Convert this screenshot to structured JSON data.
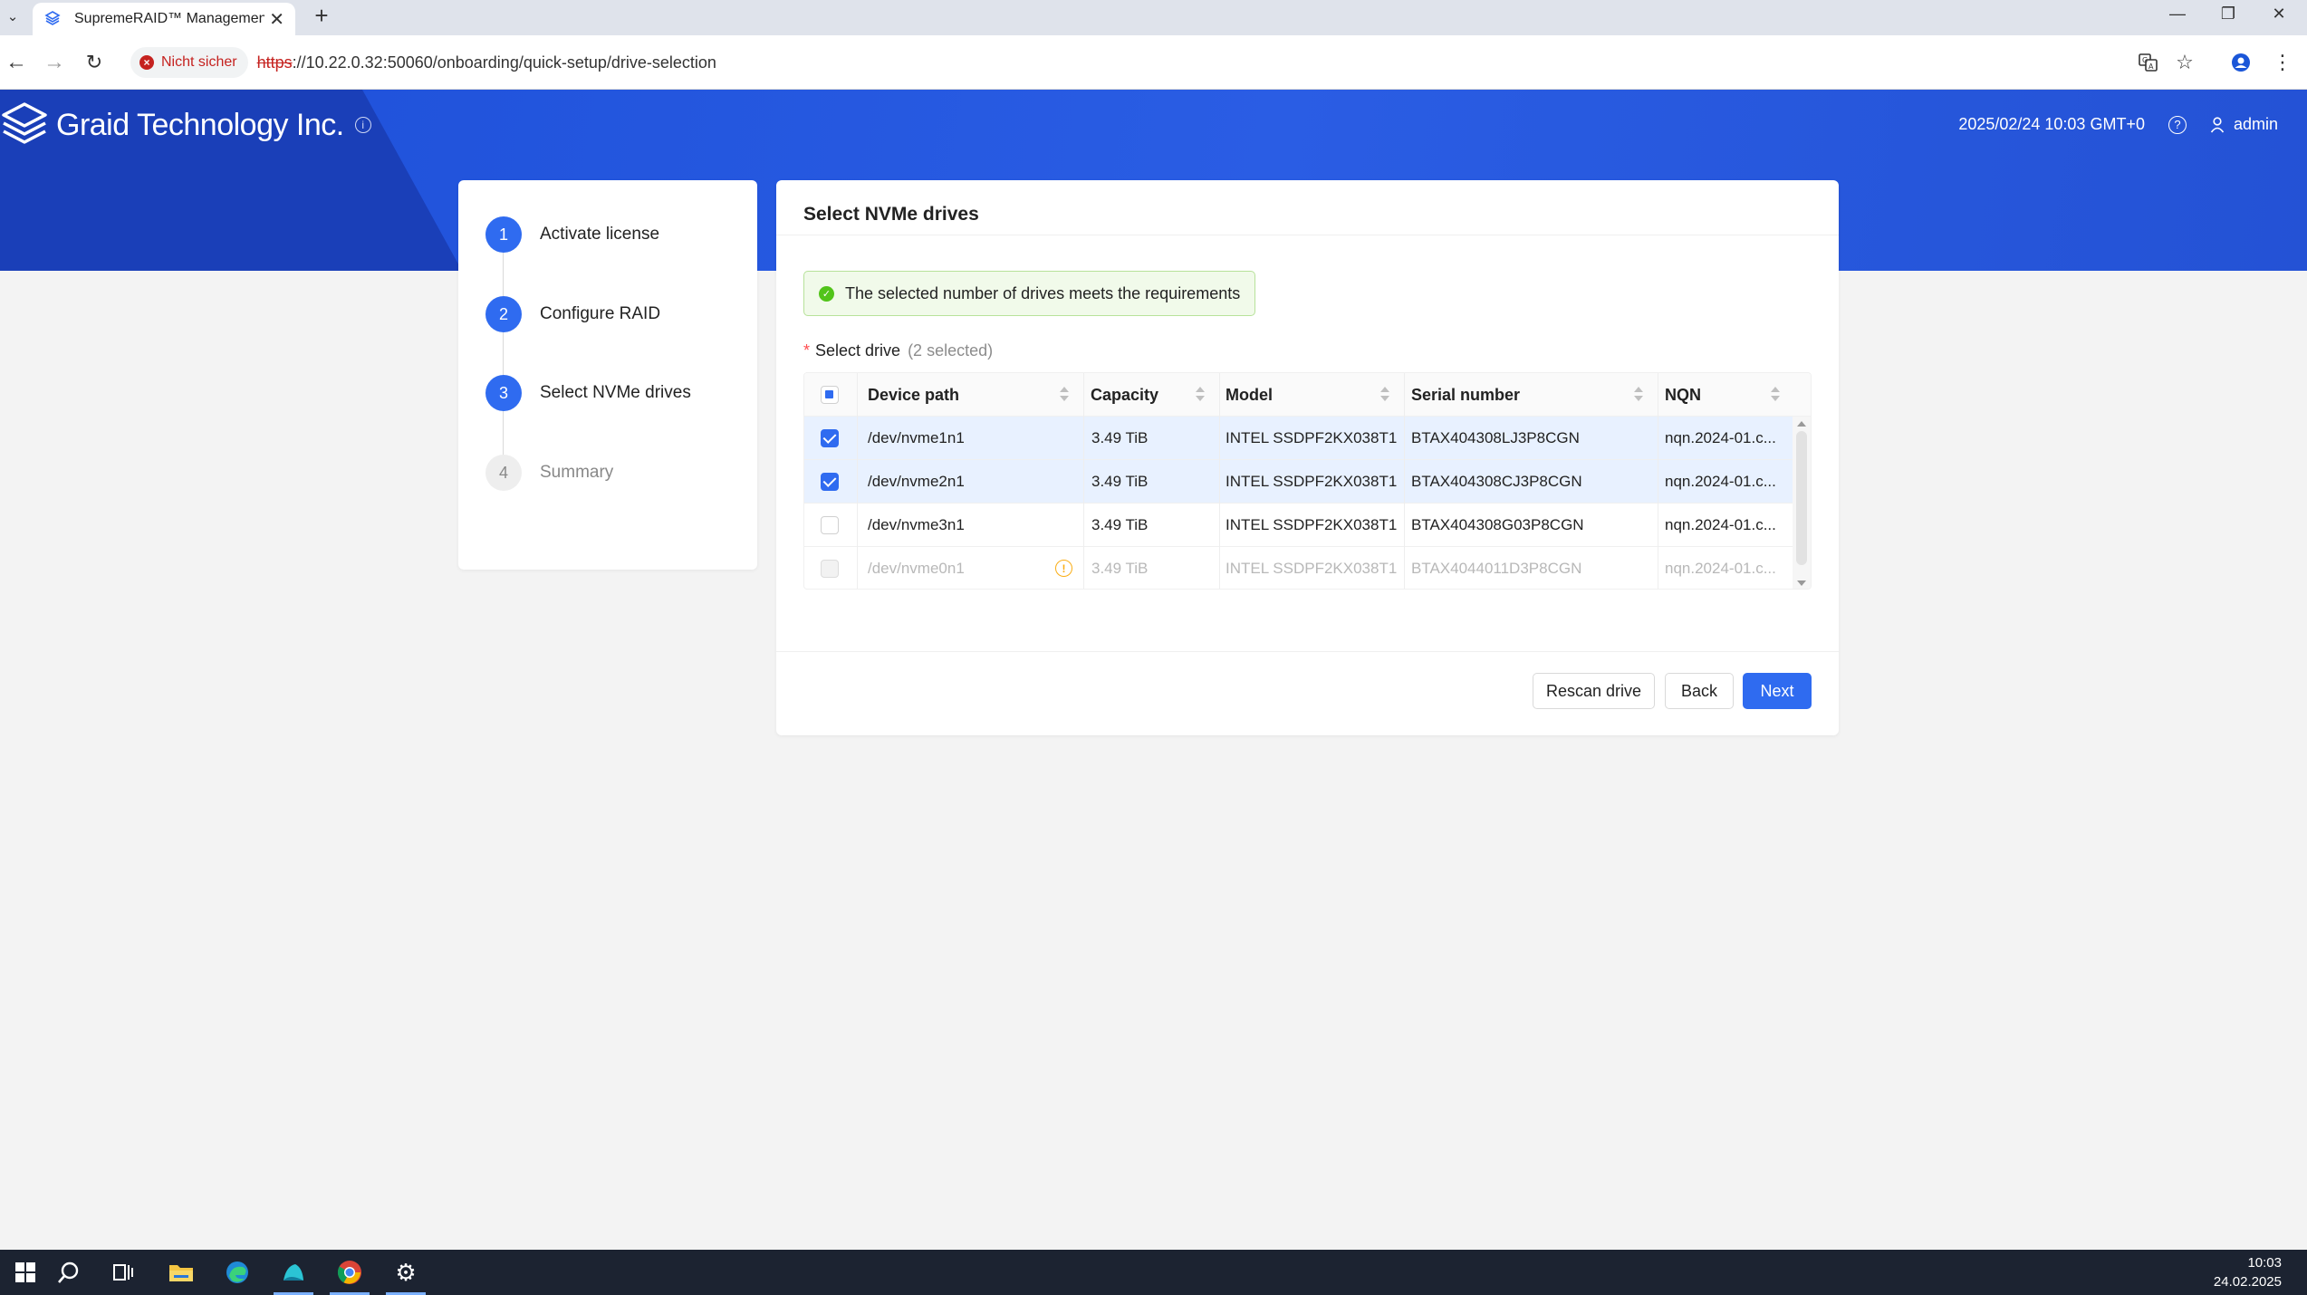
{
  "browser": {
    "tab_title": "SupremeRAID™ Management C",
    "security_label": "Nicht sicher",
    "url_scheme": "https",
    "url_rest": "://10.22.0.32:50060/onboarding/quick-setup/drive-selection"
  },
  "header": {
    "logo_text": "Graid Technology Inc.",
    "datetime": "2025/02/24 10:03 GMT+0",
    "username": "admin"
  },
  "steps": [
    {
      "num": "1",
      "label": "Activate license"
    },
    {
      "num": "2",
      "label": "Configure RAID"
    },
    {
      "num": "3",
      "label": "Select NVMe drives"
    },
    {
      "num": "4",
      "label": "Summary"
    }
  ],
  "main": {
    "title": "Select NVMe drives",
    "alert_text": "The selected number of drives meets the requirements",
    "field_label": "Select drive",
    "selected_count": "(2 selected)",
    "columns": [
      "Device path",
      "Capacity",
      "Model",
      "Serial number",
      "NQN"
    ],
    "rows": [
      {
        "path": "/dev/nvme1n1",
        "capacity": "3.49 TiB",
        "model": "INTEL SSDPF2KX038T1",
        "serial": "BTAX404308LJ3P8CGN",
        "nqn": "nqn.2024-01.c...",
        "checked": true,
        "disabled": false
      },
      {
        "path": "/dev/nvme2n1",
        "capacity": "3.49 TiB",
        "model": "INTEL SSDPF2KX038T1",
        "serial": "BTAX404308CJ3P8CGN",
        "nqn": "nqn.2024-01.c...",
        "checked": true,
        "disabled": false
      },
      {
        "path": "/dev/nvme3n1",
        "capacity": "3.49 TiB",
        "model": "INTEL SSDPF2KX038T1",
        "serial": "BTAX404308G03P8CGN",
        "nqn": "nqn.2024-01.c...",
        "checked": false,
        "disabled": false
      },
      {
        "path": "/dev/nvme0n1",
        "capacity": "3.49 TiB",
        "model": "INTEL SSDPF2KX038T1",
        "serial": "BTAX4044011D3P8CGN",
        "nqn": "nqn.2024-01.c...",
        "checked": false,
        "disabled": true
      }
    ],
    "buttons": {
      "rescan": "Rescan drive",
      "back": "Back",
      "next": "Next"
    }
  },
  "taskbar": {
    "time": "10:03",
    "date": "24.02.2025"
  },
  "colors": {
    "primary": "#2f6bf0",
    "header_blue": "#2a5de4",
    "success": "#52c41a",
    "warning": "#faad14",
    "danger": "#c5221f"
  }
}
